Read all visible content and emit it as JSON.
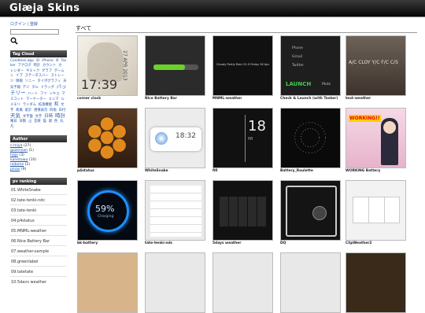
{
  "header": {
    "title": "Glæja Skins"
  },
  "sidebar": {
    "login_label": "ログイン",
    "sep": "|",
    "register_label": "登録",
    "tagcloud_title": "Tag Cloud",
    "tags": [
      {
        "t": "Condition.app",
        "s": "n"
      },
      {
        "t": "iD",
        "s": "n"
      },
      {
        "t": "iPhone",
        "s": "n"
      },
      {
        "t": "ifi",
        "s": "n"
      },
      {
        "t": "Tasker",
        "s": "n"
      },
      {
        "t": "アナログ",
        "s": "n"
      },
      {
        "t": "時計",
        "s": "n"
      },
      {
        "t": "カウント",
        "s": "n"
      },
      {
        "t": "カ",
        "s": "n"
      },
      {
        "t": "レンダー",
        "s": "n"
      },
      {
        "t": "ギミック",
        "s": "n"
      },
      {
        "t": "グラフ",
        "s": "n"
      },
      {
        "t": "ゲーム",
        "s": "n"
      },
      {
        "t": "シ",
        "s": "n"
      },
      {
        "t": "イプ",
        "s": "n"
      },
      {
        "t": "ステータスバー",
        "s": "n"
      },
      {
        "t": "ストレージ",
        "s": "n"
      },
      {
        "t": "情報",
        "s": "n"
      },
      {
        "t": "ソニー",
        "s": "n"
      },
      {
        "t": "タイポグラフィ",
        "s": "n"
      },
      {
        "t": "天気予報",
        "s": "n"
      },
      {
        "t": "デジ",
        "s": "n"
      },
      {
        "t": "タル",
        "s": "n"
      },
      {
        "t": "ドラッグ",
        "s": "n"
      },
      {
        "t": "バッテリー",
        "s": "xl"
      },
      {
        "t": "ハート",
        "s": "n"
      },
      {
        "t": "ファ",
        "s": "n"
      },
      {
        "t": "ンキョ",
        "s": "n"
      },
      {
        "t": "マスコット",
        "s": "n"
      },
      {
        "t": "マーケーター",
        "s": "n"
      },
      {
        "t": "ミニマ",
        "s": "n"
      },
      {
        "t": "ル",
        "s": "n"
      },
      {
        "t": "メモリ",
        "s": "n"
      },
      {
        "t": "ランダム",
        "s": "n"
      },
      {
        "t": "拡張機能",
        "s": "n"
      },
      {
        "t": "和",
        "s": "l"
      },
      {
        "t": "文字",
        "s": "n"
      },
      {
        "t": "和風",
        "s": "n"
      },
      {
        "t": "家計",
        "s": "n"
      },
      {
        "t": "感情表示",
        "s": "n"
      },
      {
        "t": "四角",
        "s": "n"
      },
      {
        "t": "日付",
        "s": "n"
      },
      {
        "t": "天気",
        "s": "xl"
      },
      {
        "t": "文字盤",
        "s": "n"
      },
      {
        "t": "文字",
        "s": "n"
      },
      {
        "t": "日時",
        "s": "l"
      },
      {
        "t": "時計",
        "s": "xl"
      },
      {
        "t": "曜日",
        "s": "n"
      },
      {
        "t": "日数",
        "s": "n"
      },
      {
        "t": "占",
        "s": "n"
      },
      {
        "t": "音楽",
        "s": "n"
      },
      {
        "t": "猫",
        "s": "n"
      },
      {
        "t": "歳",
        "s": "n"
      },
      {
        "t": "色",
        "s": "n"
      },
      {
        "t": "丸",
        "s": "n"
      },
      {
        "t": "凡",
        "s": "n"
      }
    ],
    "author_title": "Author",
    "authors": [
      {
        "name": "c-miya",
        "count": "(27)"
      },
      {
        "name": "gozensan",
        "count": "(1)"
      },
      {
        "name": "hajo",
        "count": "(3)"
      },
      {
        "name": "kanetawa",
        "count": "(10)"
      },
      {
        "name": "nobono",
        "count": "(2)"
      },
      {
        "name": "pinas",
        "count": "(9)"
      }
    ],
    "ranking_title": "pv ranking",
    "ranking": [
      "01.WhiteSnake",
      "02.tate-tenki-ndc",
      "03.tate-tenki",
      "04.p4status",
      "05.MNML-weather",
      "06.Nice Battery Bar",
      "07.weather-sample",
      "08.greenlabel",
      "09.tatetate",
      "10.5days weather"
    ]
  },
  "main": {
    "title": "すべて",
    "items": [
      {
        "caption": "corner clock"
      },
      {
        "caption": "Nice Battery Bar"
      },
      {
        "caption": "MNML-weather"
      },
      {
        "caption": "Check & Launch (with Tasker)"
      },
      {
        "caption": "text-weather"
      },
      {
        "caption": "p4status"
      },
      {
        "caption": "WhiteSnake"
      },
      {
        "caption": "fifi"
      },
      {
        "caption": "Battery_Roulette"
      },
      {
        "caption": "WORKING Battery"
      },
      {
        "caption": "bk-battery"
      },
      {
        "caption": "tate-tenki-ndc"
      },
      {
        "caption": "5days weather"
      },
      {
        "caption": "DQ"
      },
      {
        "caption": "ClipWeather2"
      }
    ],
    "thumb_text": {
      "t1_time": "17:39",
      "t1_date": "27 APR 2013",
      "t3_text": "Cloudy Partly Rain 22.9 Friday 26 Apr",
      "t4_lines": [
        "Phone",
        "Gmail",
        "Twitter"
      ],
      "t4_launch": "LAUNCH",
      "t4_mute": "Mute",
      "t5_text": "A/C CLOY Y/C F/C C/S",
      "t7_time": "18:32",
      "t8_big": "18",
      "t8_small": "fifi",
      "t10_text": "WORKING!!",
      "t11_pct": "59%",
      "t11_lbl": "Charging"
    }
  },
  "colors": {
    "link": "#2255aa",
    "header_bg": "#111111"
  }
}
